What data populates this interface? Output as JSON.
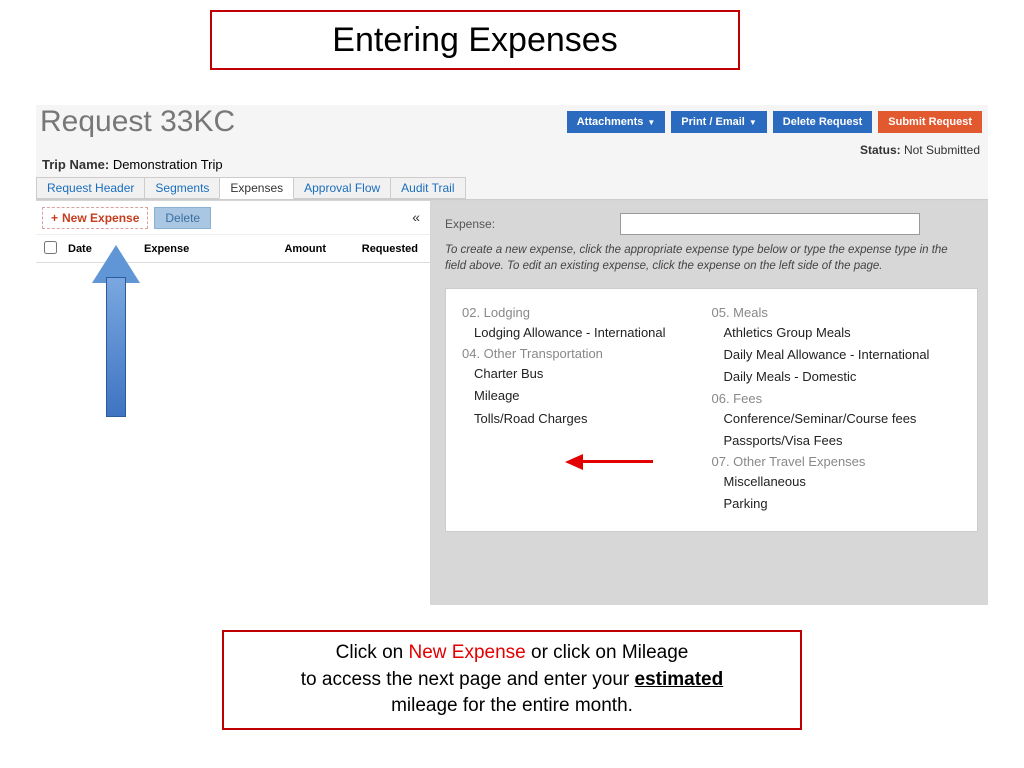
{
  "slide": {
    "title": "Entering Expenses"
  },
  "page": {
    "request_title": "Request 33KC",
    "trip_label": "Trip Name:",
    "trip_value": "Demonstration Trip",
    "status_label": "Status:",
    "status_value": "Not Submitted"
  },
  "actions": {
    "attachments": "Attachments",
    "print_email": "Print / Email",
    "delete_request": "Delete Request",
    "submit_request": "Submit Request"
  },
  "tabs": {
    "t1": "Request Header",
    "t2": "Segments",
    "t3": "Expenses",
    "t4": "Approval Flow",
    "t5": "Audit Trail"
  },
  "left": {
    "new_expense": "New Expense",
    "delete": "Delete",
    "cols": {
      "date": "Date",
      "expense": "Expense",
      "amount": "Amount",
      "requested": "Requested"
    }
  },
  "right": {
    "expense_label": "Expense:",
    "instruction": "To create a new expense, click the appropriate expense type below or type the expense type in the field above. To edit an existing expense, click the expense on the left side of the page."
  },
  "types": {
    "g02": "02. Lodging",
    "g02a": "Lodging Allowance - International",
    "g04": "04. Other Transportation",
    "g04a": "Charter Bus",
    "g04b": "Mileage",
    "g04c": "Tolls/Road Charges",
    "g05": "05. Meals",
    "g05a": "Athletics Group Meals",
    "g05b": "Daily Meal Allowance - International",
    "g05c": "Daily Meals - Domestic",
    "g06": "06. Fees",
    "g06a": "Conference/Seminar/Course fees",
    "g06b": "Passports/Visa Fees",
    "g07": "07. Other Travel Expenses",
    "g07a": "Miscellaneous",
    "g07b": "Parking"
  },
  "caption": {
    "p1": "Click on ",
    "p2": "New Expense",
    "p3": " or click on Mileage",
    "p4": "to access the next page and enter your ",
    "p5": "estimated",
    "p6": "mileage for the entire month."
  }
}
